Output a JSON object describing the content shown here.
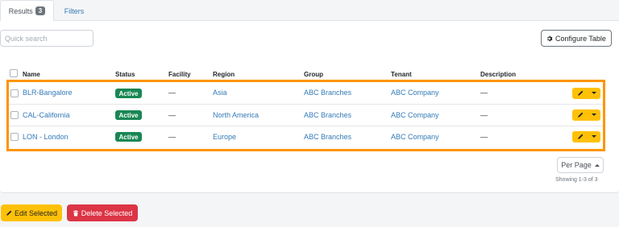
{
  "tabs": {
    "results_label": "Results",
    "results_count": "3",
    "filters_label": "Filters"
  },
  "toolbar": {
    "search_placeholder": "Quick search",
    "search_value": "",
    "configure_label": "Configure Table"
  },
  "table": {
    "headers": {
      "name": "Name",
      "status": "Status",
      "facility": "Facility",
      "region": "Region",
      "group": "Group",
      "tenant": "Tenant",
      "description": "Description"
    },
    "rows": [
      {
        "name": "BLR-Bangalore",
        "status": "Active",
        "facility": "—",
        "region": "Asia",
        "group": "ABC Branches",
        "tenant": "ABC Company",
        "description": "—"
      },
      {
        "name": "CAL-California",
        "status": "Active",
        "facility": "—",
        "region": "North America",
        "group": "ABC Branches",
        "tenant": "ABC Company",
        "description": "—"
      },
      {
        "name": "LON - London",
        "status": "Active",
        "facility": "—",
        "region": "Europe",
        "group": "ABC Branches",
        "tenant": "ABC Company",
        "description": "—"
      }
    ]
  },
  "pagination": {
    "per_page_label": "Per Page",
    "showing_text": "Showing 1-3 of 3"
  },
  "bulk_actions": {
    "edit_label": "Edit Selected",
    "delete_label": "Delete Selected"
  },
  "colors": {
    "link": "#337ab7",
    "status_active": "#198754",
    "warning": "#ffc107",
    "danger": "#dc3545",
    "highlight": "#ff9500"
  },
  "icons": {
    "configure": "gear-icon",
    "row_edit": "pencil-icon",
    "row_menu": "caret-down-icon",
    "bulk_edit": "pencil-icon",
    "bulk_delete": "trash-icon",
    "per_page": "caret-up-icon"
  }
}
